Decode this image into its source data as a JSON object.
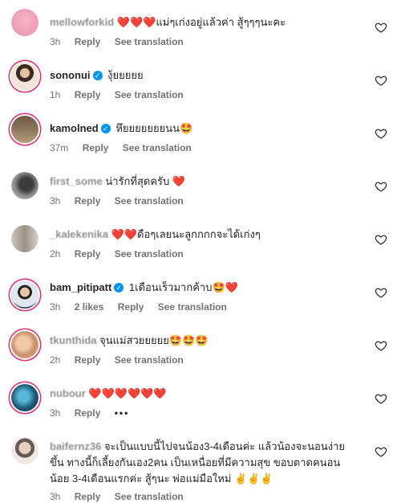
{
  "colors": {
    "accent": "#0095f6",
    "story_ring": "#e1306c",
    "meta": "#737373"
  },
  "labels": {
    "reply": "Reply",
    "see_translation": "See translation",
    "more": "•••"
  },
  "comments": [
    {
      "username": "mellowforkid",
      "verified": false,
      "blurred": true,
      "text": "❤️❤️❤️แม่ๆเก่งอยู่แล้วค่า สู้ๆๆๆนะคะ",
      "time": "3h",
      "likes": ""
    },
    {
      "username": "sononui",
      "verified": true,
      "blurred": false,
      "text": "งุ้ยยยยย",
      "time": "1h",
      "likes": ""
    },
    {
      "username": "kamolned",
      "verified": true,
      "blurred": false,
      "text": "หึยยยยยยยนน🤩",
      "time": "37m",
      "likes": ""
    },
    {
      "username": "first_some",
      "verified": false,
      "blurred": true,
      "text": "น่ารักที่สุดครับ ❤️",
      "time": "3h",
      "likes": ""
    },
    {
      "username": "_kalekenika",
      "verified": false,
      "blurred": true,
      "text": "❤️❤️ดือๆเลยนะลูกกกกจะได้เก่งๆ",
      "time": "2h",
      "likes": ""
    },
    {
      "username": "bam_pitipatt",
      "verified": true,
      "blurred": false,
      "text": "1เดือนเร็วมากค้าบ🤩❤️",
      "time": "3h",
      "likes": "2 likes"
    },
    {
      "username": "tkunthida",
      "verified": false,
      "blurred": true,
      "text": "จุนแม่สวยยยยย🤩🤩🤩",
      "time": "2h",
      "likes": ""
    },
    {
      "username": "nubour",
      "verified": false,
      "blurred": true,
      "text": "❤️❤️❤️❤️❤️❤️",
      "time": "3h",
      "likes": ""
    },
    {
      "username": "baifernz36",
      "verified": false,
      "blurred": true,
      "text": "จะเป็นแบบนี้ไปจนน้อง3-4เดือนค่ะ แล้วน้องจะนอนง่ายขึ้น ทางนี้ก็เลี้ยงกันเอง2คน เป็นเหนื่อยที่มีความสุข ขอบตาดคนอนน้อย 3-4เดือนแรกค่ะ สู้ๆนะ พ่อแม่มือใหม่ ✌️✌️✌️",
      "time": "3h",
      "likes": ""
    }
  ]
}
